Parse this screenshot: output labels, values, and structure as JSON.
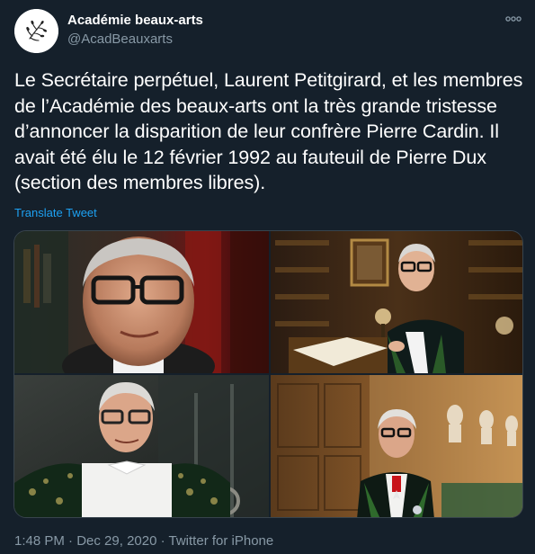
{
  "account": {
    "display_name": "Académie beaux-arts",
    "handle": "@AcadBeauxarts",
    "avatar_icon": "academie-logo-icon"
  },
  "tweet": {
    "text": "Le Secrétaire perpétuel, Laurent Petitgirard, et les membres de l’Académie des beaux-arts ont la très grande tristesse d’annoncer la disparition de leur confrère Pierre Cardin. Il avait été élu le 12 février 1992 au fauteuil de Pierre Dux (section des membres libres).",
    "translate_label": "Translate Tweet",
    "time": "1:48 PM",
    "separator": " · ",
    "date": "Dec 29, 2020",
    "source": "Twitter for iPhone"
  },
  "media": {
    "photo_count": 4
  },
  "colors": {
    "background": "#15202b",
    "text": "#ffffff",
    "secondary": "#8899a6",
    "link": "#1da1f2",
    "border": "#38444d"
  }
}
